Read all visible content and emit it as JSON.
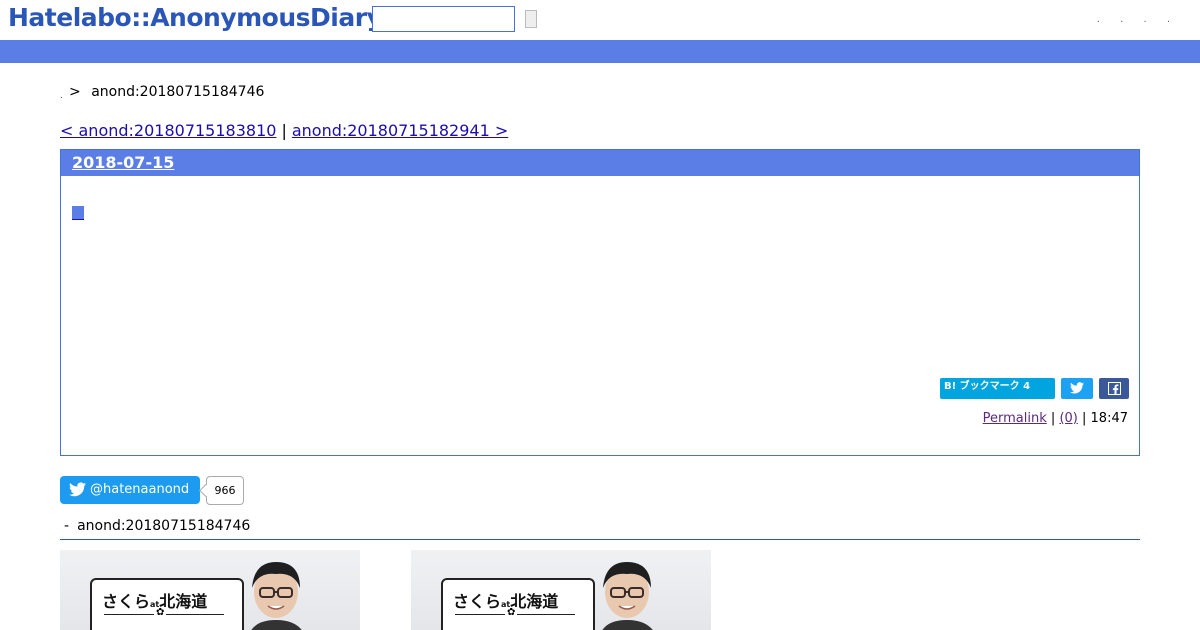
{
  "header": {
    "logo_text": "Hatelabo::AnonymousDiary",
    "search": {
      "value": "",
      "placeholder": ""
    },
    "links": [
      "·",
      "·",
      "·",
      "·"
    ]
  },
  "breadcrumb": {
    "home": ".",
    "separator": ">",
    "current": "anond:20180715184746"
  },
  "pager": {
    "prev_label": "< anond:20180715183810",
    "separator": "|",
    "next_label": "anond:20180715182941 >"
  },
  "entry": {
    "date": "2018-07-15",
    "bookmark_label": "B! ブックマーク 4",
    "footer": {
      "permalink": "Permalink",
      "sep1": "|",
      "comments": "(0)",
      "sep2": "|",
      "time": "18:47"
    }
  },
  "twitter": {
    "handle": "@hatenaanond",
    "count": "966"
  },
  "related": {
    "title": "anond:20180715184746",
    "cards": [
      {
        "title_main": "さくら",
        "title_at": "at",
        "title_place": "北海道"
      },
      {
        "title_main": "さくら",
        "title_at": "at",
        "title_place": "北海道"
      }
    ]
  },
  "colors": {
    "brand_blue": "#2a56b8",
    "bar_blue": "#5a7de6",
    "link": "#1a0dab",
    "twitter": "#1d9bf0",
    "hatena_bookmark": "#00a4de",
    "facebook": "#3b5998"
  }
}
